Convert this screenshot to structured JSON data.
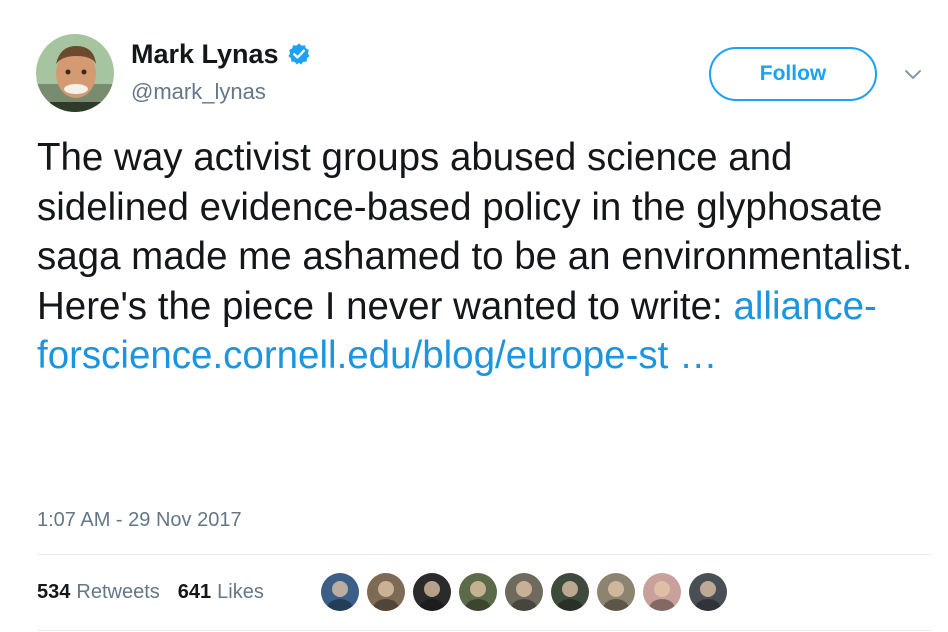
{
  "author": {
    "display_name": "Mark Lynas",
    "handle": "@mark_lynas",
    "verified": true,
    "verified_icon": "verified-badge-icon",
    "avatar": "avatar-photo"
  },
  "follow_button": {
    "label": "Follow"
  },
  "menu": {
    "icon": "chevron-down-icon"
  },
  "tweet": {
    "text": "The way activist groups abused science and sidelined evidence-based policy in the glyphosate saga made me ashamed to be an environmentalist. Here's the piece I never wanted to write:",
    "link_text": "alliance­forscience.cornell.edu/blog/europe-st  …",
    "timestamp": "1:07 AM - 29 Nov 2017"
  },
  "stats": {
    "retweets_count": "534",
    "retweets_label": "Retweets",
    "likes_count": "641",
    "likes_label": "Likes"
  },
  "likers": [
    {
      "name": "liker-avatar-1",
      "color": "#3b5f86"
    },
    {
      "name": "liker-avatar-2",
      "color": "#7d6b55"
    },
    {
      "name": "liker-avatar-3",
      "color": "#2b2b2b"
    },
    {
      "name": "liker-avatar-4",
      "color": "#5b6b4a"
    },
    {
      "name": "liker-avatar-5",
      "color": "#6e6a5e"
    },
    {
      "name": "liker-avatar-6",
      "color": "#3e4a3c"
    },
    {
      "name": "liker-avatar-7",
      "color": "#8c8470"
    },
    {
      "name": "liker-avatar-8",
      "color": "#c9a09a"
    },
    {
      "name": "liker-avatar-9",
      "color": "#4a4f55"
    }
  ],
  "colors": {
    "accent": "#1da1f2",
    "link": "#1b95e0",
    "text": "#14171a",
    "secondary_text": "#657786",
    "divider": "#e6ecf0"
  }
}
